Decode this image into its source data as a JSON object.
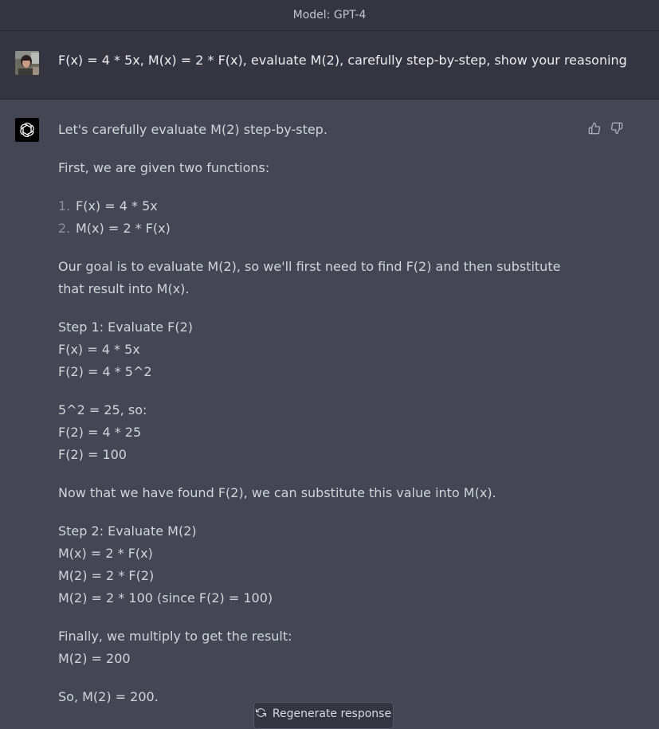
{
  "header": {
    "model_label": "Model: GPT-4"
  },
  "user_message": {
    "text": "F(x) = 4 * 5x, M(x) = 2 * F(x), evaluate M(2), carefully step-by-step, show your reasoning",
    "avatar_icon": "user-photo-avatar"
  },
  "assistant_message": {
    "avatar_icon": "openai-logo-icon",
    "intro": "Let's carefully evaluate M(2) step-by-step.",
    "given": "First, we are given two functions:",
    "functions": [
      {
        "num": "1.",
        "text": "F(x) = 4 * 5x"
      },
      {
        "num": "2.",
        "text": "M(x) = 2 * F(x)"
      }
    ],
    "goal": "Our goal is to evaluate M(2), so we'll first need to find F(2) and then substitute that result into M(x).",
    "step1": [
      "Step 1: Evaluate F(2)",
      "F(x) = 4 * 5x",
      "F(2) = 4 * 5^2"
    ],
    "step1b": [
      "5^2 = 25, so:",
      "F(2) = 4 * 25",
      "F(2) = 100"
    ],
    "transition": "Now that we have found F(2), we can substitute this value into M(x).",
    "step2": [
      "Step 2: Evaluate M(2)",
      "M(x) = 2 * F(x)",
      "M(2) = 2 * F(2)",
      "M(2) = 2 * 100 (since F(2) = 100)"
    ],
    "final": [
      "Finally, we multiply to get the result:",
      "M(2) = 200"
    ],
    "conclusion": "So, M(2) = 200."
  },
  "feedback": {
    "thumbs_up_icon": "thumbs-up-icon",
    "thumbs_down_icon": "thumbs-down-icon"
  },
  "regenerate": {
    "label": "Regenerate response",
    "icon": "refresh-icon"
  },
  "colors": {
    "page_bg": "#444654",
    "user_bg": "#343541",
    "text": "#d1d5db",
    "user_text": "#ececf1"
  }
}
